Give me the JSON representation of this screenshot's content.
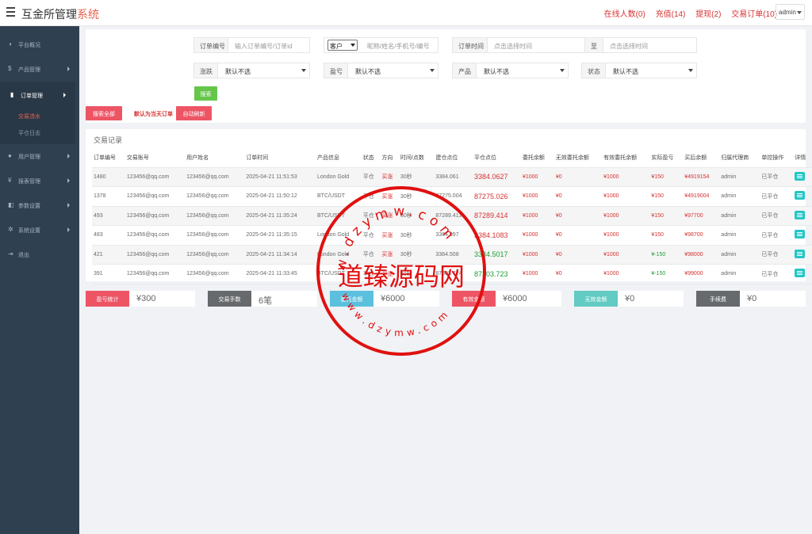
{
  "header": {
    "brand_a": "互金所管理",
    "brand_b": "系统",
    "links": [
      "在线人数(0)",
      "充值(14)",
      "提现(2)",
      "交易订单(10)"
    ],
    "user": "admin"
  },
  "sidebar": {
    "items": [
      {
        "label": "平台概况",
        "icon": "dashboard-icon"
      },
      {
        "label": "产品管理",
        "icon": "dollar-icon"
      },
      {
        "label": "订单管理",
        "icon": "orders-icon",
        "active": true,
        "children": [
          "交易流水",
          "平仓日志"
        ]
      },
      {
        "label": "用户管理",
        "icon": "user-icon"
      },
      {
        "label": "报表管理",
        "icon": "yen-icon"
      },
      {
        "label": "参数设置",
        "icon": "params-icon"
      },
      {
        "label": "系统设置",
        "icon": "gears-icon"
      },
      {
        "label": "退出",
        "icon": "logout-icon"
      }
    ]
  },
  "filters": {
    "order_no": {
      "label": "订单编号",
      "placeholder": "输入订单编号/订单id"
    },
    "customer": {
      "select": "客户",
      "placeholder": "昵称/姓名/手机号/编号"
    },
    "time": {
      "label": "订单时间",
      "placeholder": "点击选择时间",
      "to": "至",
      "placeholder2": "点击选择时间"
    },
    "updown": {
      "label": "涨跌",
      "value": "默认不选"
    },
    "profit": {
      "label": "盈亏",
      "value": "默认不选"
    },
    "product": {
      "label": "产品",
      "value": "默认不选"
    },
    "status": {
      "label": "状态",
      "value": "默认不选"
    },
    "search": "搜索",
    "search_all": "搜索全部",
    "default_hint": "默认为当天订单",
    "auto_refresh": "自动刷新"
  },
  "records": {
    "title": "交易记录",
    "columns": [
      "订单编号",
      "交易账号",
      "用户姓名",
      "订单时间",
      "产品信息",
      "状态",
      "方向",
      "时间/点数",
      "建仓点位",
      "平仓点位",
      "委托余额",
      "无效委托余额",
      "有效委托余额",
      "实际盈亏",
      "买后余额",
      "归属代理商",
      "单控操作",
      "详情"
    ],
    "rows": [
      {
        "id": "1480",
        "acct": "123456@qq.com",
        "name": "123456@qq.com",
        "time": "2025-04-21 11:51:53",
        "product": "London Gold",
        "status": "平仓",
        "dir": "买涨",
        "dur": "30秒",
        "open": "3384.061",
        "close": "3384.0627",
        "close_c": "rd",
        "amt": "¥1000",
        "invalid": "¥0",
        "valid": "¥1000",
        "pnl": "¥150",
        "pnl_c": "rd",
        "after": "¥4919154",
        "agent": "admin",
        "op": "已平仓"
      },
      {
        "id": "1378",
        "acct": "123456@qq.com",
        "name": "123456@qq.com",
        "time": "2025-04-21 11:50:12",
        "product": "BTC/USDT",
        "status": "平仓",
        "dir": "买涨",
        "dur": "30秒",
        "open": "87275.004",
        "close": "87275.026",
        "close_c": "rd",
        "amt": "¥1000",
        "invalid": "¥0",
        "valid": "¥1000",
        "pnl": "¥150",
        "pnl_c": "rd",
        "after": "¥4919004",
        "agent": "admin",
        "op": "已平仓"
      },
      {
        "id": "493",
        "acct": "123456@qq.com",
        "name": "123456@qq.com",
        "time": "2025-04-21 11:35:24",
        "product": "BTC/USDT",
        "status": "平仓",
        "dir": "买涨",
        "dur": "30秒",
        "open": "87289.413",
        "close": "87289.414",
        "close_c": "rd",
        "amt": "¥1000",
        "invalid": "¥0",
        "valid": "¥1000",
        "pnl": "¥150",
        "pnl_c": "rd",
        "after": "¥97700",
        "agent": "admin",
        "op": "已平仓"
      },
      {
        "id": "483",
        "acct": "123456@qq.com",
        "name": "123456@qq.com",
        "time": "2025-04-21 11:35:15",
        "product": "London Gold",
        "status": "平仓",
        "dir": "买涨",
        "dur": "30秒",
        "open": "3384.097",
        "close": "3384.1083",
        "close_c": "rd",
        "amt": "¥1000",
        "invalid": "¥0",
        "valid": "¥1000",
        "pnl": "¥150",
        "pnl_c": "rd",
        "after": "¥98700",
        "agent": "admin",
        "op": "已平仓"
      },
      {
        "id": "421",
        "acct": "123456@qq.com",
        "name": "123456@qq.com",
        "time": "2025-04-21 11:34:14",
        "product": "London Gold",
        "status": "平仓",
        "dir": "买涨",
        "dur": "30秒",
        "open": "3384.508",
        "close": "3384.5017",
        "close_c": "gn",
        "amt": "¥1000",
        "invalid": "¥0",
        "valid": "¥1000",
        "pnl": "¥-150",
        "pnl_c": "gn",
        "after": "¥98000",
        "agent": "admin",
        "op": "已平仓"
      },
      {
        "id": "391",
        "acct": "123456@qq.com",
        "name": "123456@qq.com",
        "time": "2025-04-21 11:33:45",
        "product": "BTC/USDT",
        "status": "平仓",
        "dir": "买涨",
        "dur": "30秒",
        "open": "87303.724",
        "close": "87303.723",
        "close_c": "gn",
        "amt": "¥1000",
        "invalid": "¥0",
        "valid": "¥1000",
        "pnl": "¥-150",
        "pnl_c": "gn",
        "after": "¥99000",
        "agent": "admin",
        "op": "已平仓"
      }
    ]
  },
  "stats": [
    {
      "label": "盈亏统计",
      "value": "¥300",
      "color": "#ed5565"
    },
    {
      "label": "交易手数",
      "value": "6笔",
      "color": "#676a6c"
    },
    {
      "label": "委托金额",
      "value": "¥6000",
      "color": "#5bc0de"
    },
    {
      "label": "有效金额",
      "value": "¥6000",
      "color": "#ed5565"
    },
    {
      "label": "无效金额",
      "value": "¥0",
      "color": "#62cbc3"
    },
    {
      "label": "手续费",
      "value": "¥0",
      "color": "#676a6c"
    }
  ],
  "watermark": {
    "text": "道臻源码网",
    "url_top": "w.dzymw.com",
    "url_bottom": "www.dzymw.com"
  },
  "colors": {
    "sidebar": "#2f4050",
    "accent_red": "#ed5565",
    "danger": "#d63333",
    "success": "#65c64a",
    "info": "#23c6c8"
  }
}
